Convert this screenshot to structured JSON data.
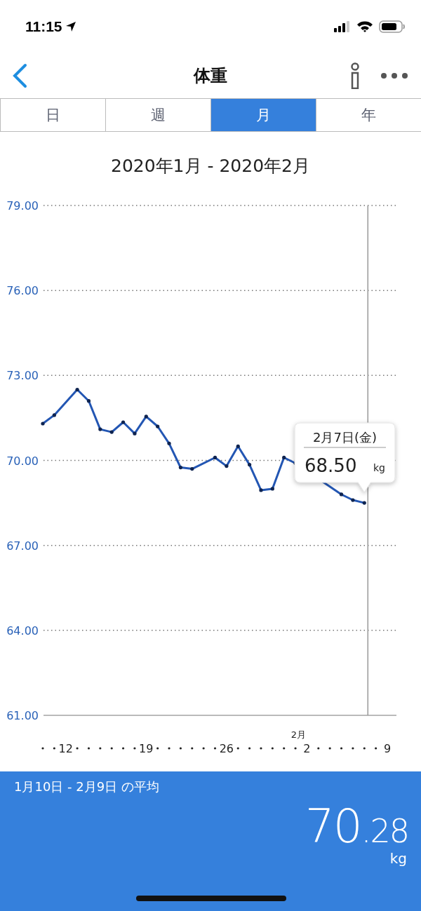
{
  "status_bar": {
    "time": "11:15"
  },
  "header": {
    "title": "体重"
  },
  "tabs": [
    {
      "label": "日",
      "selected": false
    },
    {
      "label": "週",
      "selected": false
    },
    {
      "label": "月",
      "selected": true
    },
    {
      "label": "年",
      "selected": false
    }
  ],
  "chart": {
    "title": "2020年1月 - 2020年2月",
    "chart_data": {
      "type": "line",
      "categories": [
        null,
        null,
        "12",
        null,
        null,
        null,
        null,
        null,
        null,
        "19",
        null,
        null,
        null,
        null,
        null,
        null,
        "26",
        null,
        null,
        null,
        null,
        null,
        null,
        "2",
        null,
        null,
        null,
        null,
        null,
        null,
        "9"
      ],
      "series": [
        {
          "color": "#2356b3",
          "values": [
            71.3,
            71.6,
            null,
            72.5,
            72.1,
            71.1,
            71.0,
            71.35,
            70.95,
            71.55,
            71.2,
            70.6,
            69.75,
            69.7,
            null,
            70.1,
            69.8,
            70.5,
            69.85,
            68.95,
            69.0,
            70.1,
            69.9,
            null,
            null,
            null,
            68.8,
            68.6,
            68.5,
            null,
            null
          ]
        }
      ],
      "grid": true,
      "ylim": [
        61,
        79
      ],
      "yticks": [
        {
          "value": 79,
          "label": "79.00"
        },
        {
          "value": 76,
          "label": "76.00"
        },
        {
          "value": 73,
          "label": "73.00"
        },
        {
          "value": 70,
          "label": "70.00"
        },
        {
          "value": 67,
          "label": "67.00"
        },
        {
          "value": 64,
          "label": "64.00"
        },
        {
          "value": 61,
          "label": "61.00"
        }
      ],
      "annotations": [
        {
          "text": "2月"
        }
      ]
    },
    "tooltip": {
      "date": "2月7日(金)",
      "value": "68.50",
      "unit": "kg"
    }
  },
  "average": {
    "label": "1月10日 - 2月9日 の平均",
    "value_integer": "70",
    "value_decimal": ".28",
    "unit": "kg"
  }
}
